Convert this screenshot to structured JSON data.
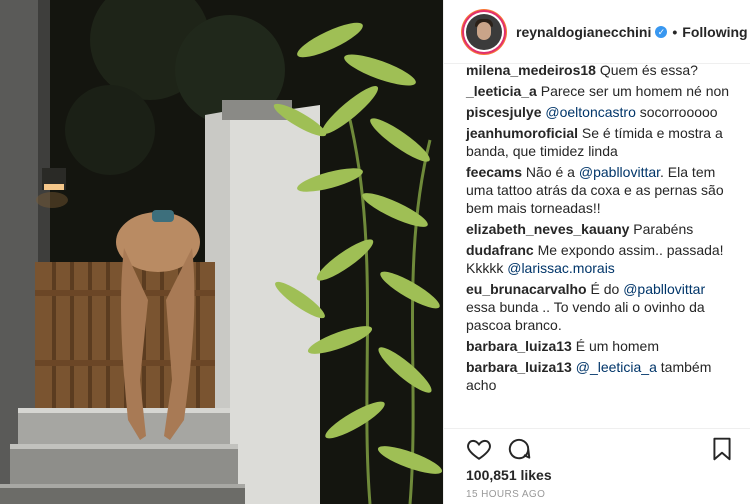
{
  "post": {
    "username": "reynaldogianecchini",
    "follow_label": "Following",
    "dot": "•",
    "verified_glyph": "✓",
    "likes": "100,851 likes",
    "time": "15 HOURS AGO"
  },
  "comments": [
    {
      "user": "milena_medeiros18",
      "parts": [
        {
          "t": " Quem és essa?"
        }
      ]
    },
    {
      "user": "_leeticia_a",
      "parts": [
        {
          "t": " Parece ser um homem né non"
        }
      ]
    },
    {
      "user": "piscesjulye",
      "parts": [
        {
          "m": " @oeltoncastro"
        },
        {
          "t": " socorrooooo"
        }
      ]
    },
    {
      "user": "jeanhumoroficial",
      "parts": [
        {
          "t": " Se é tímida e mostra a banda, que timidez linda"
        }
      ]
    },
    {
      "user": "feecams",
      "parts": [
        {
          "t": " Não é a "
        },
        {
          "m": "@pabllovittar"
        },
        {
          "t": ". Ela tem uma tattoo atrás da coxa e as pernas são bem mais torneadas!!"
        }
      ]
    },
    {
      "user": "elizabeth_neves_kauany",
      "parts": [
        {
          "t": " Parabéns"
        }
      ]
    },
    {
      "user": "dudafranc",
      "parts": [
        {
          "t": " Me expondo assim.. passada! Kkkkk "
        },
        {
          "m": "@larissac.morais"
        }
      ]
    },
    {
      "user": "eu_brunacarvalho",
      "parts": [
        {
          "t": " É do "
        },
        {
          "m": "@pabllovittar"
        },
        {
          "t": " essa bunda .. To vendo ali o ovinho da pascoa branco."
        }
      ]
    },
    {
      "user": "barbara_luiza13",
      "parts": [
        {
          "t": " É um homem"
        }
      ]
    },
    {
      "user": "barbara_luiza13",
      "parts": [
        {
          "t": " "
        },
        {
          "m": "@_leeticia_a"
        },
        {
          "t": " também acho"
        }
      ]
    }
  ],
  "icons": {
    "like": "heart-icon",
    "comment": "comment-bubble-icon",
    "save": "bookmark-icon"
  },
  "colors": {
    "mention": "#003569",
    "verified": "#3897f0",
    "text": "#262626",
    "muted": "#999999"
  }
}
